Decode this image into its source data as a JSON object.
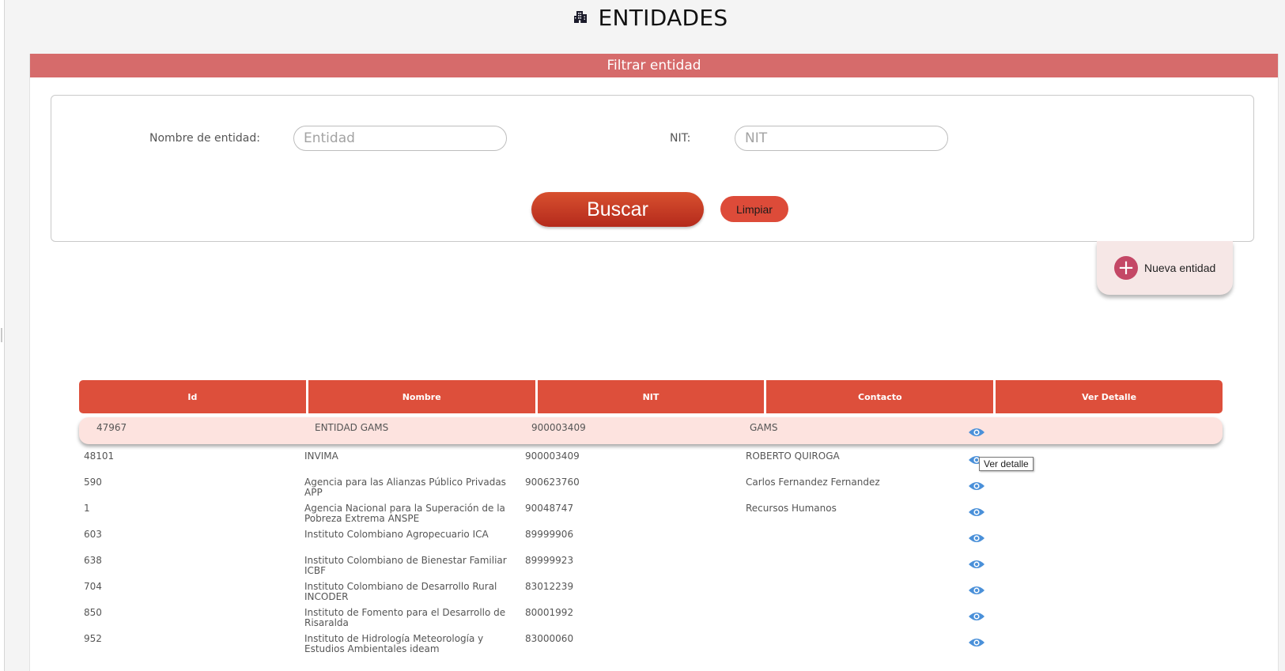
{
  "header": {
    "title": "ENTIDADES",
    "icon": "building-icon"
  },
  "filter": {
    "bar_title": "Filtrar entidad",
    "name_label": "Nombre de entidad:",
    "name_placeholder": "Entidad",
    "nit_label": "NIT:",
    "nit_placeholder": "NIT",
    "search_label": "Buscar",
    "clear_label": "Limpiar"
  },
  "new_entity": {
    "label": "Nueva entidad",
    "icon": "plus-circle-icon"
  },
  "table": {
    "columns": [
      "Id",
      "Nombre",
      "NIT",
      "Contacto",
      "Ver Detalle"
    ],
    "rows": [
      {
        "id": "47967",
        "name": "ENTIDAD GAMS",
        "nit": "900003409",
        "contact": "GAMS"
      },
      {
        "id": "48101",
        "name": "INVIMA",
        "nit": "900003409",
        "contact": "ROBERTO QUIROGA"
      },
      {
        "id": "590",
        "name": "Agencia para las Alianzas Público Privadas APP",
        "nit": "900623760",
        "contact": "Carlos Fernandez Fernandez"
      },
      {
        "id": "1",
        "name": "Agencia Nacional para la Superación de la Pobreza Extrema ANSPE",
        "nit": "90048747",
        "contact": "Recursos Humanos"
      },
      {
        "id": "603",
        "name": "Instituto Colombiano Agropecuario ICA",
        "nit": "89999906",
        "contact": ""
      },
      {
        "id": "638",
        "name": "Instituto Colombiano de Bienestar Familiar ICBF",
        "nit": "89999923",
        "contact": ""
      },
      {
        "id": "704",
        "name": "Instituto Colombiano de Desarrollo Rural INCODER",
        "nit": "83012239",
        "contact": ""
      },
      {
        "id": "850",
        "name": "Instituto de Fomento para el Desarrollo de Risaralda",
        "nit": "80001992",
        "contact": ""
      },
      {
        "id": "952",
        "name": "Instituto de Hidrología Meteorología y Estudios Ambientales ideam",
        "nit": "83000060",
        "contact": ""
      }
    ],
    "detail_icon": "eye-icon",
    "tooltip": "Ver detalle"
  },
  "colors": {
    "bar": "#d66b6b",
    "header_cell": "#dd4f3b",
    "primary_button": "#c0392b",
    "highlight_row": "#fde3df",
    "eye": "#4a90d9",
    "new_entity_plus": "#c44866"
  }
}
